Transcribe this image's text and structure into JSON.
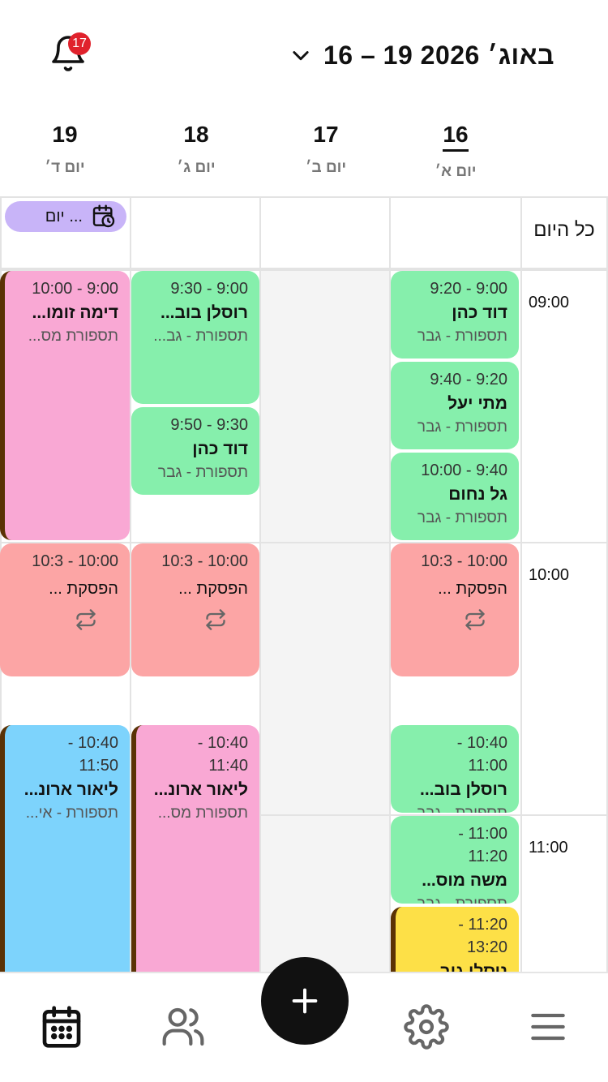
{
  "header": {
    "range_title": "16 – 19 באוג׳ 2026",
    "notification_count": "17"
  },
  "days": [
    {
      "num": "16",
      "name": "יום א׳",
      "today": true
    },
    {
      "num": "17",
      "name": "יום ב׳",
      "today": false
    },
    {
      "num": "18",
      "name": "יום ג׳",
      "today": false
    },
    {
      "num": "19",
      "name": "יום ד׳",
      "today": false
    }
  ],
  "grid": {
    "allday_label": "כל היום",
    "hours": [
      "09:00",
      "10:00",
      "11:00"
    ],
    "allday_event": "יום ..."
  },
  "events": {
    "d16_1": {
      "time": "9:00 - 9:20",
      "title": "דוד כהן",
      "sub": "תספורת - גבר",
      "color": "#86efac"
    },
    "d16_2": {
      "time": "9:20 - 9:40",
      "title": "מתי יעל",
      "sub": "תספורת - גבר",
      "color": "#86efac"
    },
    "d16_3": {
      "time": "9:40 - 10:00",
      "title": "גל נחום",
      "sub": "תספורת - גבר",
      "color": "#86efac"
    },
    "d16_break": {
      "time": "10:00 - 10:3",
      "title": "הפסקת ...",
      "color": "#fca5a5"
    },
    "d16_4": {
      "time1": "10:40 -",
      "time2": "11:00",
      "title": "רוסלן בוב...",
      "sub": "תספורת - גבר",
      "color": "#86efac"
    },
    "d16_5": {
      "time1": "11:00 -",
      "time2": "11:20",
      "title": "משה מוס...",
      "sub": "תספורת - גבר",
      "color": "#86efac"
    },
    "d16_6": {
      "time1": "11:20 -",
      "time2": "13:20",
      "title": "ניסלי גוב...",
      "color": "#fde047"
    },
    "d18_1": {
      "time": "9:00 - 9:30",
      "title": "רוסלן בוב...",
      "sub": "תספורת - גב...",
      "color": "#86efac"
    },
    "d18_2": {
      "time": "9:30 - 9:50",
      "title": "דוד כהן",
      "sub": "תספורת - גבר",
      "color": "#86efac"
    },
    "d18_break": {
      "time": "10:00 - 10:3",
      "title": "הפסקת ...",
      "color": "#fca5a5"
    },
    "d18_3": {
      "time1": "10:40 -",
      "time2": "11:40",
      "title": "ליאור ארונ...",
      "sub": "תספורת מס...",
      "color": "#f9a8d4"
    },
    "d19_1": {
      "time": "9:00 - 10:00",
      "title": "דימה זומו...",
      "sub": "תספורת מס...",
      "color": "#f9a8d4"
    },
    "d19_break": {
      "time": "10:00 - 10:3",
      "title": "הפסקת ...",
      "color": "#fca5a5"
    },
    "d19_2": {
      "time1": "10:40 -",
      "time2": "11:50",
      "title": "ליאור ארונ...",
      "sub": "תספורת - אי...",
      "color": "#7dd3fc"
    }
  },
  "bottom_nav": {
    "items": [
      "calendar-icon",
      "users-icon",
      "plus-icon",
      "gear-icon",
      "menu-icon"
    ]
  }
}
